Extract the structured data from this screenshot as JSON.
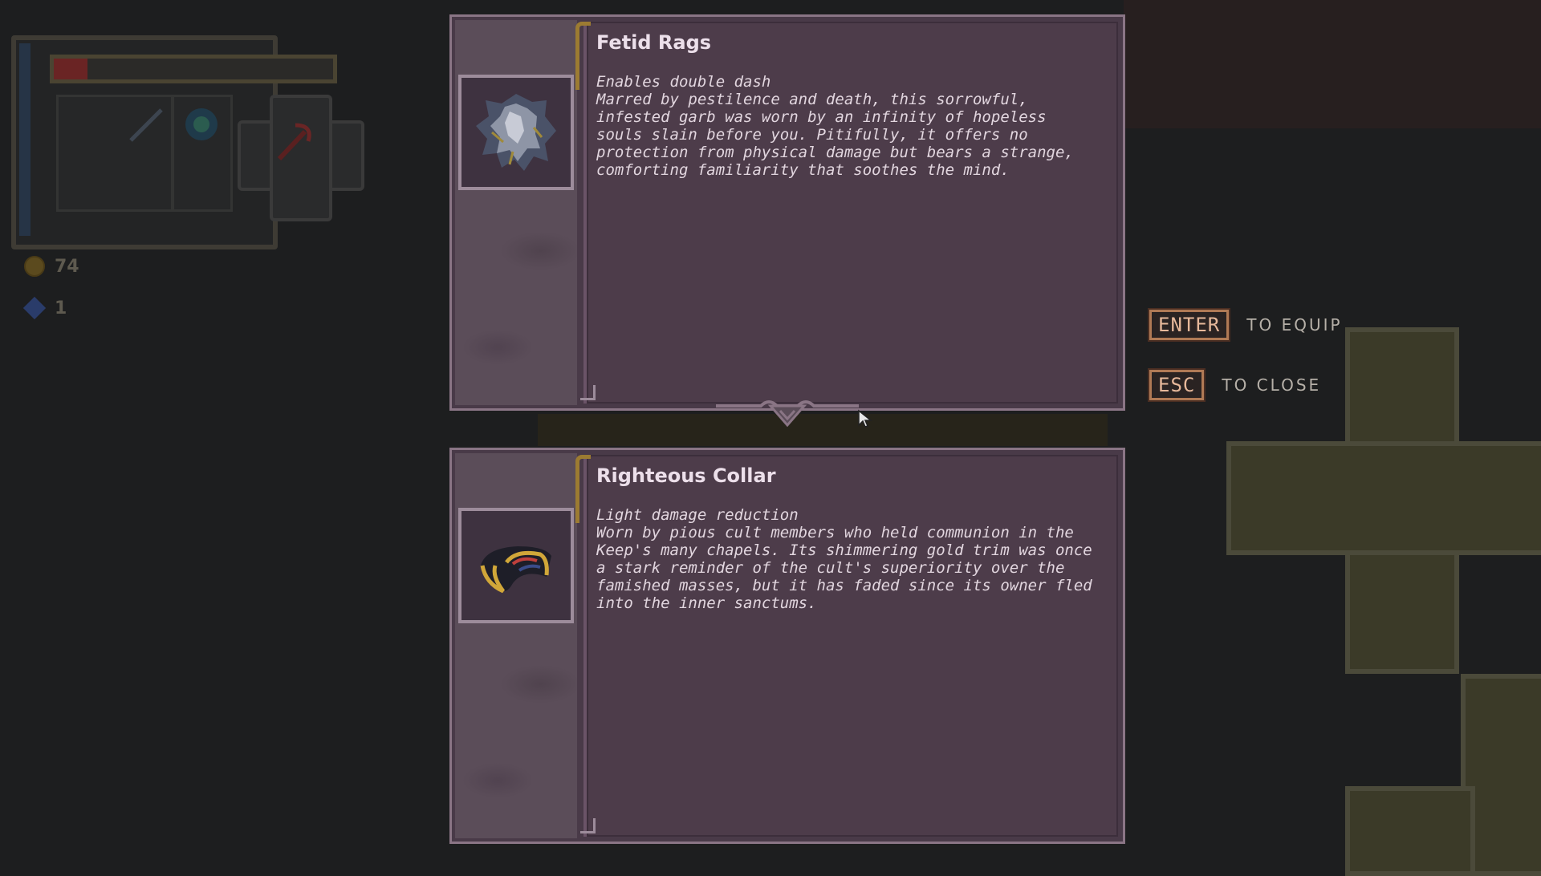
{
  "hud": {
    "coins": "74",
    "gems": "1",
    "health_fraction": 0.12,
    "icons": [
      "coin-icon",
      "gem-icon",
      "sword-icon",
      "helmet-icon",
      "scythe-icon"
    ]
  },
  "items": [
    {
      "name": "Fetid Rags",
      "effect": "Enables double dash",
      "description": "Marred by pestilence and death, this sorrowful,\ninfested garb was worn by an infinity of hopeless\nsouls slain before you. Pitifully, it offers no\nprotection from physical damage but bears a strange,\ncomforting familiarity that soothes the mind.",
      "icon": "tattered-rags-icon"
    },
    {
      "name": "Righteous Collar",
      "effect": "Light damage reduction",
      "description": "Worn by pious cult members who held communion in the\nKeep's many chapels. Its shimmering gold trim was once\na stark reminder of the cult's superiority over the\nfamished masses, but it has faded since its owner fled\ninto the inner sanctums.",
      "icon": "gold-collar-icon"
    }
  ],
  "prompts": {
    "enter_key": "ENTER",
    "enter_text": "TO EQUIP",
    "esc_key": "ESC",
    "esc_text": "TO CLOSE"
  },
  "colors": {
    "panel_bg": "#4d3c4a",
    "gold_trim": "#9c7b32",
    "key_border": "#b07a55"
  }
}
